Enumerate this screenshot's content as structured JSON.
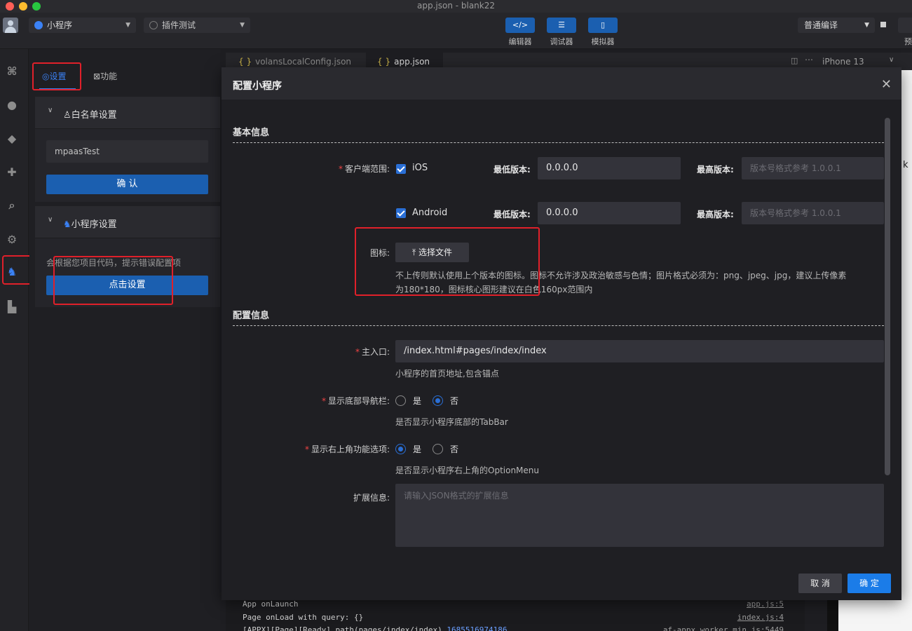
{
  "window": {
    "title": "app.json - blank22"
  },
  "toolbar": {
    "mini_program_select": "小程序",
    "plugin_select": "插件测试",
    "editor_label": "编辑器",
    "debugger_label": "调试器",
    "simulator_label": "模拟器",
    "compile_mode": "普通编译",
    "preview_label": "预"
  },
  "sidebar": {
    "tab_settings": "设置",
    "tab_features": "功能",
    "whitelist": {
      "title": "白名单设置",
      "input_value": "mpaasTest",
      "confirm_label": "确 认"
    },
    "mini_settings": {
      "title": "小程序设置",
      "desc": "会根据您项目代码，提示错误配置项",
      "button_label": "点击设置"
    }
  },
  "editor": {
    "tabs": [
      {
        "label": "volansLocalConfig.json"
      },
      {
        "label": "app.json"
      }
    ],
    "device": "iPhone 13",
    "console": [
      {
        "text": "App onLaunch",
        "source": "app.js:5"
      },
      {
        "text": "Page onLoad with query: {}",
        "source": "index.js:4"
      },
      {
        "text": "[APPX][Page][Ready] path(pages/index/index) ",
        "ts": "1685516974186",
        "source": "af-appx.worker.min.js:5449"
      }
    ],
    "sim_text": "k"
  },
  "modal": {
    "title": "配置小程序",
    "basic_section": "基本信息",
    "client_range_label": "客户端范围:",
    "ios_label": "iOS",
    "android_label": "Android",
    "min_version_label": "最低版本:",
    "max_version_label": "最高版本:",
    "ios_min_version": "0.0.0.0",
    "android_min_version": "0.0.0.0",
    "max_version_placeholder": "版本号格式参考 1.0.0.1",
    "icon_label": "图标:",
    "upload_label": "选择文件",
    "icon_hint_1": "不上传则默认使用上个版本的图标。图标不允许涉及政治敏感与色情；图片格式必须为：png、jpeg、jpg，建议上传像素",
    "icon_hint_2": "为180*180，图标核心图形建议在白色160px范围内",
    "config_section": "配置信息",
    "entry_label": "主入口:",
    "entry_value": "/index.html#pages/index/index",
    "entry_hint": "小程序的首页地址,包含锚点",
    "tabbar_label": "显示底部导航栏:",
    "tabbar_hint": "是否显示小程序底部的TabBar",
    "option_label": "显示右上角功能选项:",
    "option_hint": "是否显示小程序右上角的OptionMenu",
    "yes": "是",
    "no": "否",
    "ext_label": "扩展信息:",
    "ext_placeholder": "请输入JSON格式的扩展信息",
    "cancel": "取 消",
    "ok": "确 定",
    "tabbar_selected": "否",
    "option_selected": "是"
  },
  "colors": {
    "accent": "#1b5fb0",
    "primary_button": "#1b7ce8",
    "highlight": "#e0202a",
    "required": "#f04444"
  }
}
